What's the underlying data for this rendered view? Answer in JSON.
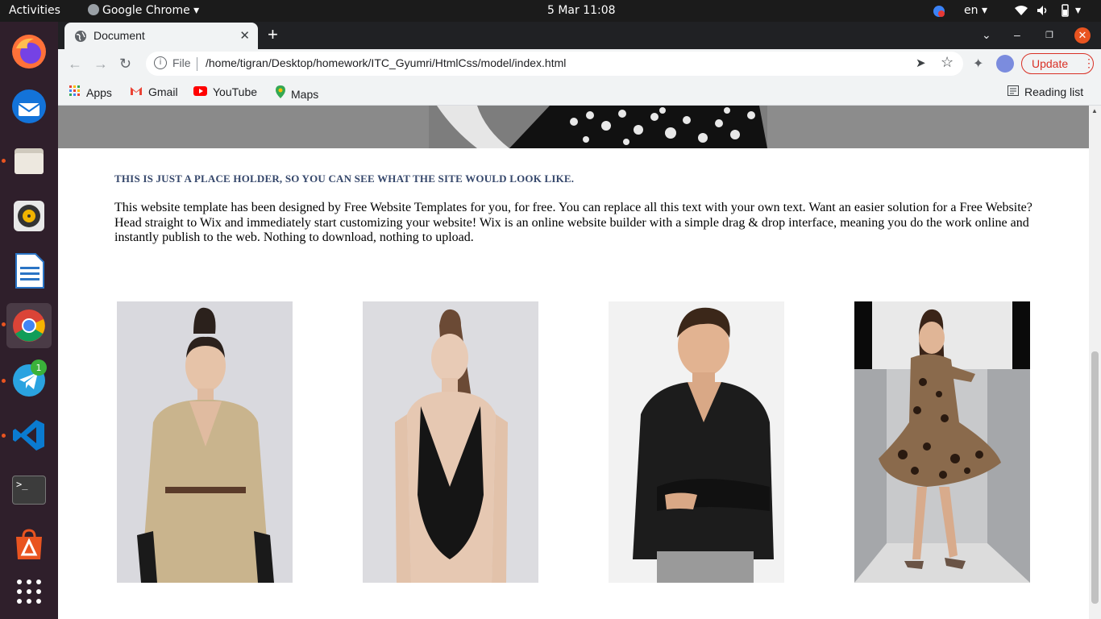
{
  "topbar": {
    "activities": "Activities",
    "app_menu": "Google Chrome",
    "datetime": "5 Mar  11:08",
    "language": "en"
  },
  "dock": {
    "apps": [
      {
        "name": "Firefox",
        "icon": "firefox-icon"
      },
      {
        "name": "Thunderbird",
        "icon": "thunderbird-icon"
      },
      {
        "name": "Files",
        "icon": "files-icon"
      },
      {
        "name": "Rhythmbox",
        "icon": "rhythmbox-icon"
      },
      {
        "name": "LibreOffice Writer",
        "icon": "writer-icon"
      },
      {
        "name": "Google Chrome",
        "icon": "chrome-icon"
      },
      {
        "name": "Telegram",
        "icon": "telegram-icon",
        "badge": "1"
      },
      {
        "name": "Visual Studio Code",
        "icon": "vscode-icon"
      },
      {
        "name": "Terminal",
        "icon": "terminal-icon",
        "glyph": ">_"
      },
      {
        "name": "Ubuntu Software",
        "icon": "software-center-icon"
      },
      {
        "name": "Show Applications",
        "icon": "app-grid-icon"
      }
    ]
  },
  "browser": {
    "tab_title": "Document",
    "scheme_label": "File",
    "url": "/home/tigran/Desktop/homework/ITC_Gyumri/HtmlCss/model/index.html",
    "update_label": "Update",
    "bookmarks": [
      {
        "label": "Apps",
        "icon": "apps-grid-icon"
      },
      {
        "label": "Gmail",
        "icon": "gmail-icon"
      },
      {
        "label": "YouTube",
        "icon": "youtube-icon"
      },
      {
        "label": "Maps",
        "icon": "maps-icon"
      }
    ],
    "reading_list": "Reading list"
  },
  "page": {
    "placeholder_heading": "THIS IS JUST A PLACE HOLDER, SO YOU CAN SEE WHAT THE SITE WOULD LOOK LIKE.",
    "body_text": "This website template has been designed by Free Website Templates for you, for free. You can replace all this text with your own text. Want an easier solution for a Free Website? Head straight to Wix and immediately start customizing your website! Wix is an online website builder with a simple drag & drop interface, meaning you do the work online and instantly publish to the web. Nothing to download, nothing to upload.",
    "photos": [
      {
        "subject": "model in beige trench dress"
      },
      {
        "subject": "model in black swimsuit"
      },
      {
        "subject": "male model in black sweater"
      },
      {
        "subject": "model in leopard print dress"
      }
    ]
  },
  "colors": {
    "accent": "#e95420",
    "heading": "#35476b",
    "update": "#d93025"
  }
}
